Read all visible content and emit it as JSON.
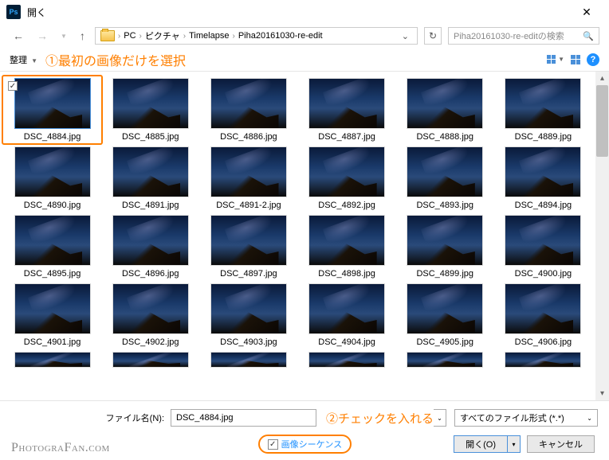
{
  "window": {
    "app_icon": "Ps",
    "title": "開く",
    "close": "✕"
  },
  "nav": {
    "breadcrumbs": [
      "PC",
      "ピクチャ",
      "Timelapse",
      "Piha20161030-re-edit"
    ],
    "search_placeholder": "Piha20161030-re-editの検索"
  },
  "toolbar": {
    "organize": "整理"
  },
  "annotations": {
    "a1": "①最初の画像だけを選択",
    "a2": "②チェックを入れる"
  },
  "files": [
    {
      "name": "DSC_4884.jpg",
      "selected": true
    },
    {
      "name": "DSC_4885.jpg"
    },
    {
      "name": "DSC_4886.jpg"
    },
    {
      "name": "DSC_4887.jpg"
    },
    {
      "name": "DSC_4888.jpg"
    },
    {
      "name": "DSC_4889.jpg"
    },
    {
      "name": "DSC_4890.jpg"
    },
    {
      "name": "DSC_4891.jpg"
    },
    {
      "name": "DSC_4891-2.jpg"
    },
    {
      "name": "DSC_4892.jpg"
    },
    {
      "name": "DSC_4893.jpg"
    },
    {
      "name": "DSC_4894.jpg"
    },
    {
      "name": "DSC_4895.jpg"
    },
    {
      "name": "DSC_4896.jpg"
    },
    {
      "name": "DSC_4897.jpg"
    },
    {
      "name": "DSC_4898.jpg"
    },
    {
      "name": "DSC_4899.jpg"
    },
    {
      "name": "DSC_4900.jpg"
    },
    {
      "name": "DSC_4901.jpg"
    },
    {
      "name": "DSC_4902.jpg"
    },
    {
      "name": "DSC_4903.jpg"
    },
    {
      "name": "DSC_4904.jpg"
    },
    {
      "name": "DSC_4905.jpg"
    },
    {
      "name": "DSC_4906.jpg"
    }
  ],
  "footer": {
    "filename_label": "ファイル名(N):",
    "filename_value": "DSC_4884.jpg",
    "filetype": "すべてのファイル形式 (*.*)",
    "sequence_label": "画像シーケンス",
    "open_btn": "開く(O)",
    "cancel_btn": "キャンセル"
  },
  "watermark": "PhotograFan.com"
}
